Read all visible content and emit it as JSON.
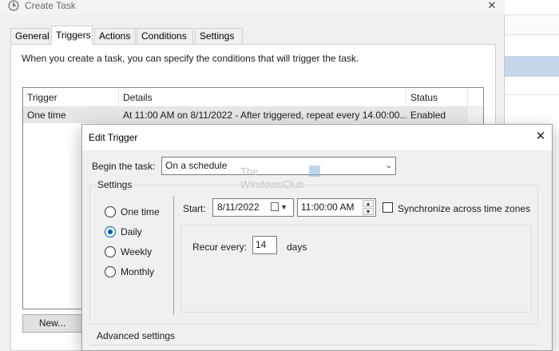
{
  "create_task": {
    "title": "Create Task",
    "tabs": [
      {
        "label": "General",
        "active": false
      },
      {
        "label": "Triggers",
        "active": true
      },
      {
        "label": "Actions",
        "active": false
      },
      {
        "label": "Conditions",
        "active": false
      },
      {
        "label": "Settings",
        "active": false
      }
    ],
    "description": "When you create a task, you can specify the conditions that will trigger the task.",
    "columns": [
      "Trigger",
      "Details",
      "Status"
    ],
    "rows": [
      {
        "trigger": "One time",
        "details": "At 11:00 AM on 8/11/2022 - After triggered, repeat every 14.00:00...",
        "status": "Enabled"
      }
    ],
    "new_button": "New..."
  },
  "edit_trigger": {
    "title": "Edit Trigger",
    "begin_label": "Begin the task:",
    "begin_value": "On a schedule",
    "settings_label": "Settings",
    "schedule_options": [
      {
        "label": "One time",
        "checked": false
      },
      {
        "label": "Daily",
        "checked": true
      },
      {
        "label": "Weekly",
        "checked": false
      },
      {
        "label": "Monthly",
        "checked": false
      }
    ],
    "start_label": "Start:",
    "start_date": "8/11/2022",
    "start_time": "11:00:00 AM",
    "sync_label": "Synchronize across time zones",
    "sync_checked": false,
    "recur_label": "Recur every:",
    "recur_value": "14",
    "recur_unit": "days",
    "advanced_label": "Advanced settings"
  },
  "watermark": {
    "line1": "The",
    "line2": "WindowsClub"
  },
  "colors": {
    "accent": "#005fb8",
    "selected_row": "#e6e6e6",
    "window_bg": "#f0f0f0"
  },
  "icons": {
    "title_icon": "clock-icon",
    "close": "close-icon",
    "dropdown": "chevron-down-icon",
    "calendar": "calendar-icon"
  }
}
